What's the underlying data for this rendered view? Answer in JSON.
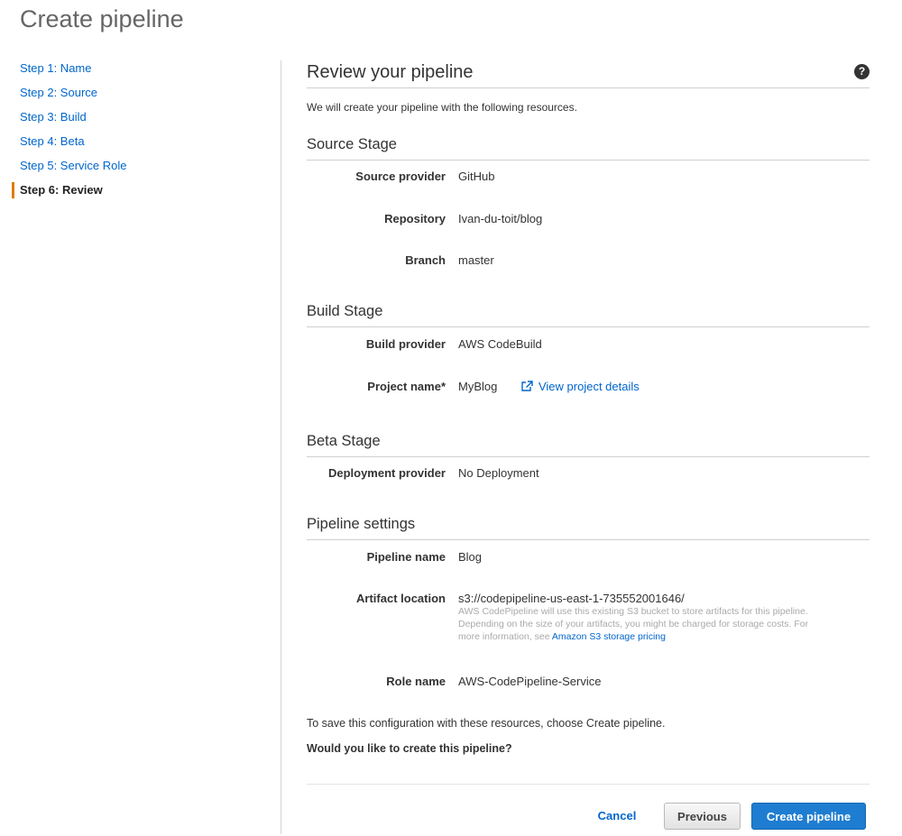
{
  "page_title": "Create pipeline",
  "steps": [
    {
      "label": "Step 1: Name",
      "active": false
    },
    {
      "label": "Step 2: Source",
      "active": false
    },
    {
      "label": "Step 3: Build",
      "active": false
    },
    {
      "label": "Step 4: Beta",
      "active": false
    },
    {
      "label": "Step 5: Service Role",
      "active": false
    },
    {
      "label": "Step 6: Review",
      "active": true
    }
  ],
  "review": {
    "title": "Review your pipeline",
    "help_icon": "question-circle-icon",
    "help_glyph": "?",
    "intro": "We will create your pipeline with the following resources."
  },
  "source_stage": {
    "title": "Source Stage",
    "provider_label": "Source provider",
    "provider_value": "GitHub",
    "repo_label": "Repository",
    "repo_value": "Ivan-du-toit/blog",
    "branch_label": "Branch",
    "branch_value": "master"
  },
  "build_stage": {
    "title": "Build Stage",
    "provider_label": "Build provider",
    "provider_value": "AWS CodeBuild",
    "project_label": "Project name*",
    "project_value": "MyBlog",
    "project_link": "View project details",
    "project_link_icon": "external-link-icon"
  },
  "beta_stage": {
    "title": "Beta Stage",
    "deploy_label": "Deployment provider",
    "deploy_value": "No Deployment"
  },
  "pipeline_settings": {
    "title": "Pipeline settings",
    "name_label": "Pipeline name",
    "name_value": "Blog",
    "artifact_label": "Artifact location",
    "artifact_value": "s3://codepipeline-us-east-1-735552001646/",
    "artifact_note": "AWS CodePipeline will use this existing S3 bucket to store artifacts for this pipeline. Depending on the size of your artifacts, you might be charged for storage costs. For more information, see",
    "artifact_note_link": "Amazon S3 storage pricing",
    "role_label": "Role name",
    "role_value": "AWS-CodePipeline-Service"
  },
  "footer": {
    "save_text": "To save this configuration with these resources, choose Create pipeline.",
    "question": "Would you like to create this pipeline?",
    "cancel_label": "Cancel",
    "previous_label": "Previous",
    "create_label": "Create pipeline"
  },
  "colors": {
    "link": "#0066cc",
    "active_step_marker": "#e07b00",
    "primary_button": "#1f7dd1"
  }
}
